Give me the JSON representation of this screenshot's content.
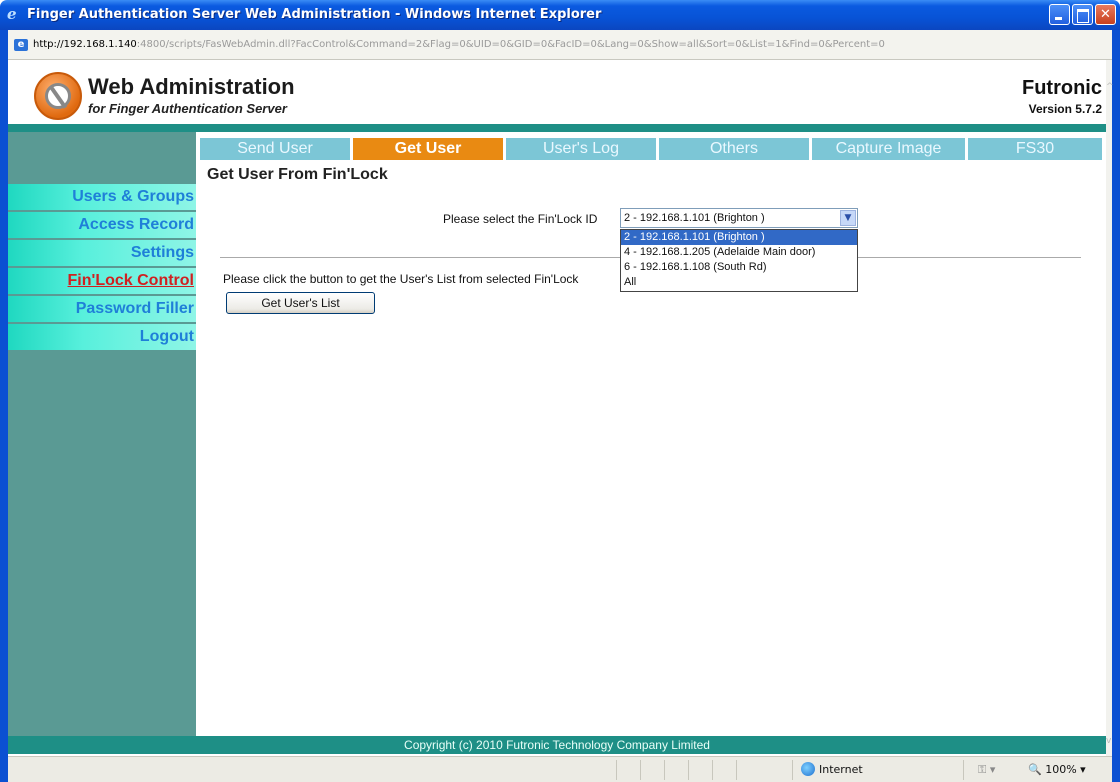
{
  "window": {
    "title": "Finger Authentication Server Web Administration - Windows Internet Explorer"
  },
  "address": {
    "host": "http://192.168.1.140",
    "rest": ":4800/scripts/FasWebAdmin.dll?FacControl&Command=2&Flag=0&UID=0&GID=0&FacID=0&Lang=0&Show=all&Sort=0&List=1&Find=0&Percent=0"
  },
  "header": {
    "title": "Web Administration",
    "subtitle": "for Finger Authentication Server",
    "brand": "Futronic",
    "version": "Version 5.7.2"
  },
  "sidebar": {
    "items": [
      {
        "label": "Users & Groups"
      },
      {
        "label": "Access Record"
      },
      {
        "label": "Settings"
      },
      {
        "label": "Fin'Lock Control",
        "active": true
      },
      {
        "label": "Password Filler"
      },
      {
        "label": "Logout"
      }
    ]
  },
  "tabs": [
    {
      "label": "Send User"
    },
    {
      "label": "Get User",
      "active": true
    },
    {
      "label": "User's Log"
    },
    {
      "label": "Others"
    },
    {
      "label": "Capture Image"
    },
    {
      "label": "FS30"
    }
  ],
  "main": {
    "heading": "Get User From Fin'Lock",
    "select_label": "Please select the Fin'Lock ID",
    "selected_value": "2 - 192.168.1.101 (Brighton )",
    "options": [
      "2 - 192.168.1.101 (Brighton )",
      "4 - 192.168.1.205 (Adelaide Main door)",
      "6 - 192.168.1.108 (South Rd)",
      "All"
    ],
    "instruction": "Please click the button to get the User's List from selected Fin'Lock",
    "button_label": "Get User's List"
  },
  "footer": {
    "copyright": "Copyright (c) 2010 Futronic Technology Company Limited"
  },
  "statusbar": {
    "zone": "Internet",
    "zoom": "100%"
  },
  "colors": {
    "sidebar_bg": "#5a9a94",
    "sidebar_item": "#1fd8c0",
    "tab": "#7cc6d6",
    "tab_active": "#e98a12",
    "band": "#1e8f86"
  }
}
